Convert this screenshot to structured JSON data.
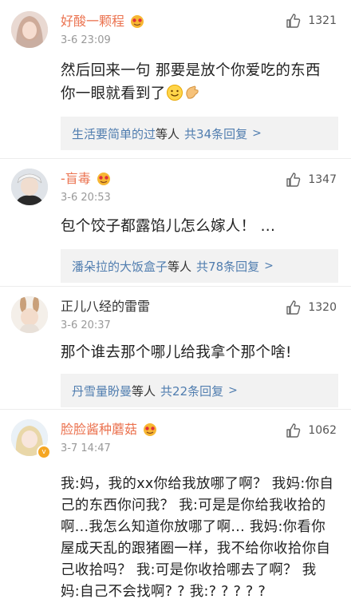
{
  "comments": [
    {
      "name": "好酸一颗程",
      "time": "3-6 23:09",
      "likes": "1321",
      "text": "然后回来一句  那要是放个你爱吃的东西 你一眼就看到了",
      "reply_name": "生活要简单的过",
      "reply_mid": "等人",
      "reply_count": "共34条回复",
      "reply_arrow": ">"
    },
    {
      "name": "-盲毒",
      "time": "3-6 20:53",
      "likes": "1347",
      "text": "包个饺子都露馅儿怎么嫁人！  ...",
      "reply_name": "潘朵拉的大饭盒子",
      "reply_mid": "等人",
      "reply_count": "共78条回复",
      "reply_arrow": ">"
    },
    {
      "name": "正儿八经的雷雷",
      "time": "3-6 20:37",
      "likes": "1320",
      "text": "那个谁去那个哪儿给我拿个那个啥!",
      "reply_name": "丹雪量盼曼",
      "reply_mid": "等人",
      "reply_count": "共22条回复",
      "reply_arrow": ">"
    },
    {
      "name": "脸脸酱种蘑菇",
      "time": "3-7 14:47",
      "likes": "1062",
      "text": "我:妈，我的xx你给我放哪了啊？ 我妈:你自己的东西你问我？ 我:可是是你给我收拾的啊...我怎么知道你放哪了啊... 我妈:你看你屋成天乱的跟猪圈一样，我不给你收拾你自己收拾吗？  我:可是你收拾哪去了啊？ 我妈:自己不会找啊? ?  我:? ? ? ? ?"
    }
  ],
  "colors": {
    "vip_name": "#eb7350",
    "link": "#507daf",
    "reply_bg": "#f2f2f2"
  },
  "icons": [
    "thumbs-up-icon",
    "vip-emoji-icon",
    "smile-emoji-icon",
    "clap-emoji-icon",
    "verified-badge-icon"
  ]
}
